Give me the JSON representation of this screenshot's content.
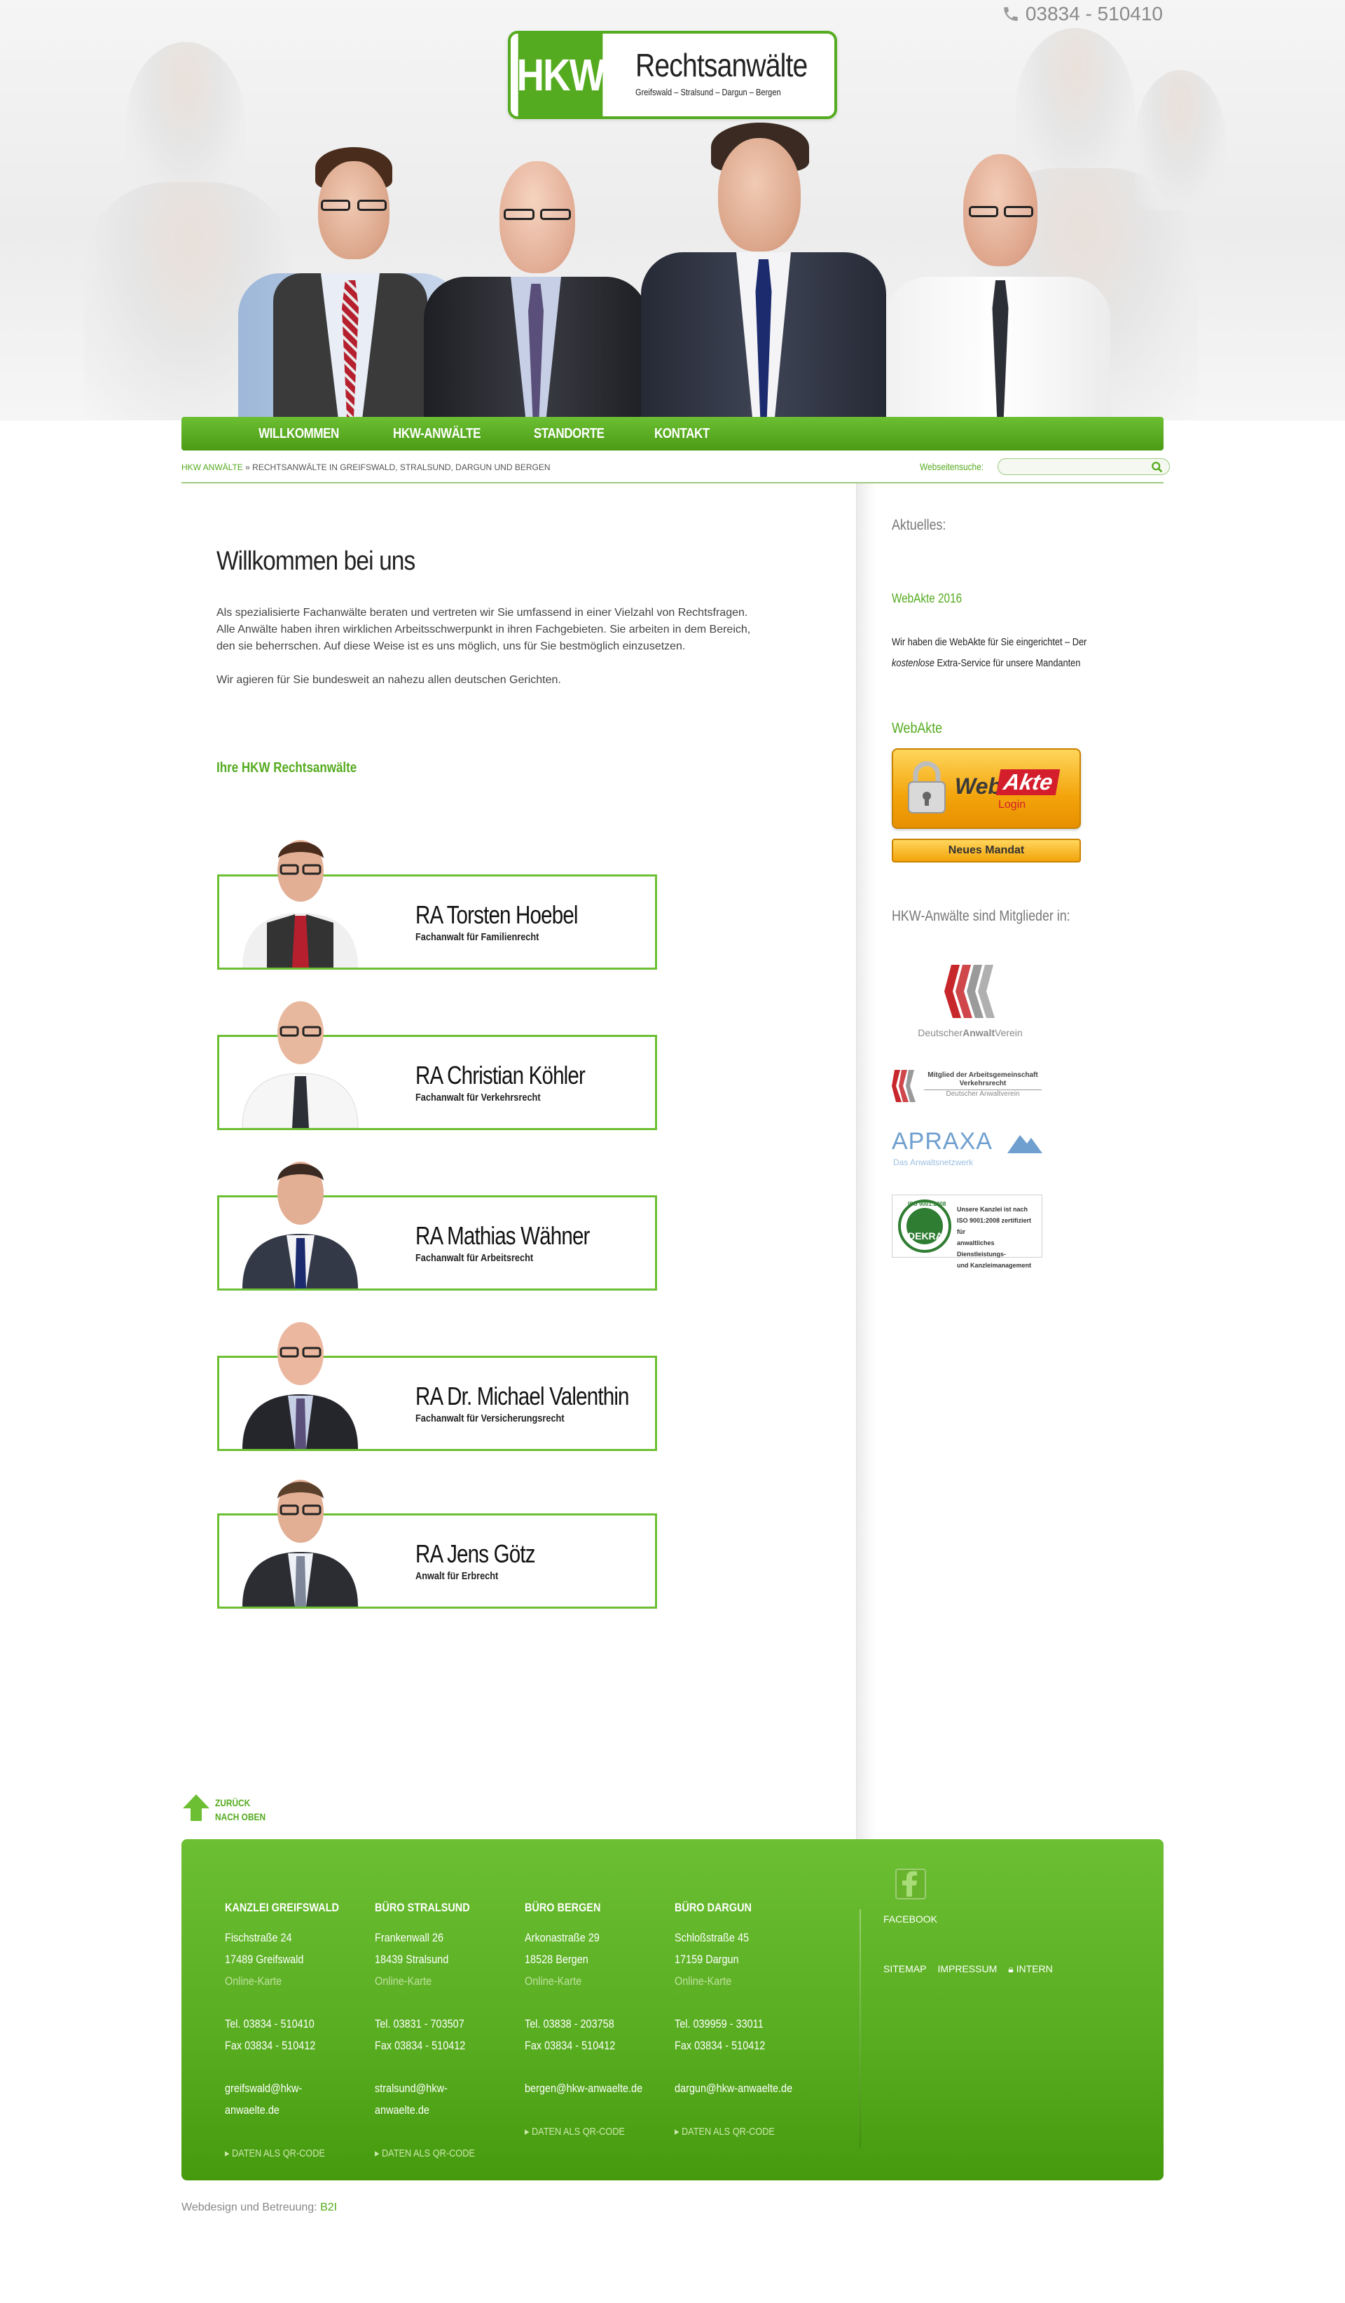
{
  "header": {
    "phone": "03834 - 510410",
    "logo_mark": "HKW",
    "logo_title": "Rechtsanwälte",
    "logo_subtitle": "Greifswald – Stralsund – Dargun – Bergen"
  },
  "nav": [
    "WILLKOMMEN",
    "HKW-ANWÄLTE",
    "STANDORTE",
    "KONTAKT"
  ],
  "breadcrumb": {
    "home": "HKW ANWÄLTE",
    "current": "» RECHTSANWÄLTE IN GREIFSWALD, STRALSUND, DARGUN UND BERGEN"
  },
  "search": {
    "label": "Webseitensuche:",
    "placeholder": ""
  },
  "main": {
    "title": "Willkommen bei uns",
    "paragraph1": "Als spezialisierte Fachanwälte beraten und vertreten wir Sie umfassend in einer Vielzahl von Rechtsfragen. Alle Anwälte haben ihren wirklichen Arbeitsschwerpunkt in ihren Fachgebieten. Sie arbeiten in dem Bereich, den sie beherrschen. Auf diese Weise ist es uns möglich, uns für Sie bestmöglich einzusetzen.",
    "paragraph2": "Wir agieren für Sie bundesweit an nahezu allen deutschen Gerichten.",
    "team_heading": "Ihre HKW Rechtsanwälte"
  },
  "lawyers": [
    {
      "name": "RA Torsten Hoebel",
      "role": "Fachanwalt für Familienrecht"
    },
    {
      "name": "RA Christian Köhler",
      "role": "Fachanwalt für Verkehrsrecht"
    },
    {
      "name": "RA Mathias Wähner",
      "role": "Fachanwalt für Arbeitsrecht"
    },
    {
      "name": "RA Dr. Michael Valenthin",
      "role": "Fachanwalt für Versicherungsrecht"
    },
    {
      "name": "RA Jens Götz",
      "role": "Anwalt für Erbrecht"
    }
  ],
  "sidebar": {
    "news_heading": "Aktuelles:",
    "news_link": "WebAkte 2016",
    "news_text_1": "Wir haben die WebAkte für Sie eingerichtet – Der",
    "news_text_2_em": "kostenlose",
    "news_text_2": "Extra-Service für unsere Mandanten",
    "webakte_heading": "WebAkte",
    "webakte_web": "Web",
    "webakte_akte": "Akte",
    "webakte_login": "Login",
    "new_case_button": "Neues Mandat",
    "members_heading": "HKW-Anwälte sind Mitglieder in:",
    "logo_dav_1": "Deutscher",
    "logo_dav_2": "Anwalt",
    "logo_dav_3": "Verein",
    "logo_arge_1": "Mitglied der Arbeitsgemeinschaft",
    "logo_arge_2": "Verkehrsrecht",
    "logo_arge_3": "Deutscher Anwaltverein",
    "logo_apraxa": "APRAXA",
    "logo_apraxa_sub": "Das Anwaltsnetzwerk",
    "logo_dekra_top": "ISO 9001:2008",
    "logo_dekra": "DEKRA",
    "logo_dekra_text_1": "Unsere Kanzlei ist nach",
    "logo_dekra_text_2": "ISO 9001:2008 zertifiziert für",
    "logo_dekra_text_3": "anwaltliches Dienstleistungs-",
    "logo_dekra_text_4": "und Kanzleimanagement"
  },
  "back_to_top": [
    "ZURÜCK",
    "NACH OBEN"
  ],
  "offices": [
    {
      "heading": "KANZLEI GREIFSWALD",
      "street": "Fischstraße 24",
      "city": "17489 Greifswald",
      "map": "Online-Karte",
      "tel": "Tel. 03834 - 510410",
      "fax": "Fax 03834 - 510412",
      "email": "greifswald@hkw-anwaelte.de",
      "qr": "DATEN ALS QR-CODE"
    },
    {
      "heading": "BÜRO STRALSUND",
      "street": "Frankenwall 26",
      "city": "18439 Stralsund",
      "map": "Online-Karte",
      "tel": "Tel. 03831 - 703507",
      "fax": "Fax 03834 - 510412",
      "email": "stralsund@hkw-anwaelte.de",
      "qr": "DATEN ALS QR-CODE"
    },
    {
      "heading": "BÜRO BERGEN",
      "street": "Arkonastraße 29",
      "city": "18528 Bergen",
      "map": "Online-Karte",
      "tel": "Tel. 03838 - 203758",
      "fax": "Fax 03834 - 510412",
      "email": "bergen@hkw-anwaelte.de",
      "qr": "DATEN ALS QR-CODE"
    },
    {
      "heading": "BÜRO DARGUN",
      "street": "Schloßstraße 45",
      "city": "17159 Dargun",
      "map": "Online-Karte",
      "tel": "Tel. 039959 - 33011",
      "fax": "Fax 03834 - 510412",
      "email": "dargun@hkw-anwaelte.de",
      "qr": "DATEN ALS QR-CODE"
    }
  ],
  "footer": {
    "facebook": "FACEBOOK",
    "links": [
      "SITEMAP",
      "IMPRESSUM",
      "INTERN"
    ],
    "credit_label": "Webdesign und Betreuung:",
    "credit_link": "B2I"
  },
  "colors": {
    "brand_green": "#55ab1f",
    "nav_green": "#6cbf32",
    "button_orange": "#f3a40b",
    "webakte_red": "#d41e2b"
  }
}
